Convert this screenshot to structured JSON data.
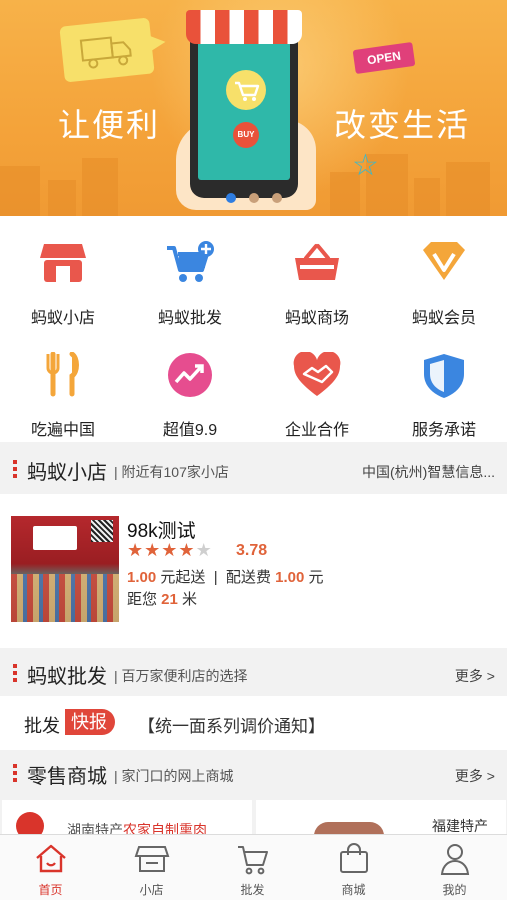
{
  "banner": {
    "slogan_left": "让便利",
    "slogan_right": "改变生活",
    "open_tag": "OPEN",
    "buy_label": "BUY",
    "dots": 3,
    "active_dot": 0
  },
  "grid": {
    "items": [
      {
        "label": "蚂蚁小店",
        "icon": "shop-awning-icon"
      },
      {
        "label": "蚂蚁批发",
        "icon": "cart-plus-icon"
      },
      {
        "label": "蚂蚁商场",
        "icon": "basket-icon"
      },
      {
        "label": "蚂蚁会员",
        "icon": "diamond-v-icon"
      },
      {
        "label": "吃遍中国",
        "icon": "fork-knife-icon"
      },
      {
        "label": "超值9.9",
        "icon": "trend-up-icon"
      },
      {
        "label": "企业合作",
        "icon": "handshake-heart-icon"
      },
      {
        "label": "服务承诺",
        "icon": "shield-icon"
      }
    ]
  },
  "section_store": {
    "title": "蚂蚁小店",
    "subtitle": "| 附近有107家小店",
    "right": "中国(杭州)智慧信息..."
  },
  "store": {
    "name": "98k测试",
    "rating": "3.78",
    "stars_filled": 4,
    "stars_total": 5,
    "min_order": "1.00",
    "min_order_suffix": " 元起送  |  配送费 ",
    "delivery_fee": "1.00",
    "delivery_suffix": " 元",
    "distance_prefix": "距您 ",
    "distance": "21",
    "distance_unit": " 米"
  },
  "section_wholesale": {
    "title": "蚂蚁批发",
    "subtitle": "| 百万家便利店的选择",
    "more": "更多 >"
  },
  "news": {
    "label_a": "批发",
    "label_b": "快报",
    "text": "【统一面系列调价通知】"
  },
  "section_retail": {
    "title": "零售商城",
    "subtitle": "| 家门口的网上商城",
    "more": "更多 >"
  },
  "products": {
    "left_prefix": "湖南特产",
    "left_highlight": "农家自制熏肉",
    "right_text": "福建特产"
  },
  "colors": {
    "accent": "#d9342b",
    "price": "#e0633a",
    "banner": "#f4a33a"
  },
  "tabbar": {
    "tabs": [
      {
        "label": "首页",
        "icon": "home-icon",
        "active": true
      },
      {
        "label": "小店",
        "icon": "store-icon",
        "active": false
      },
      {
        "label": "批发",
        "icon": "cart-icon",
        "active": false
      },
      {
        "label": "商城",
        "icon": "bag-icon",
        "active": false
      },
      {
        "label": "我的",
        "icon": "user-icon",
        "active": false
      }
    ]
  }
}
